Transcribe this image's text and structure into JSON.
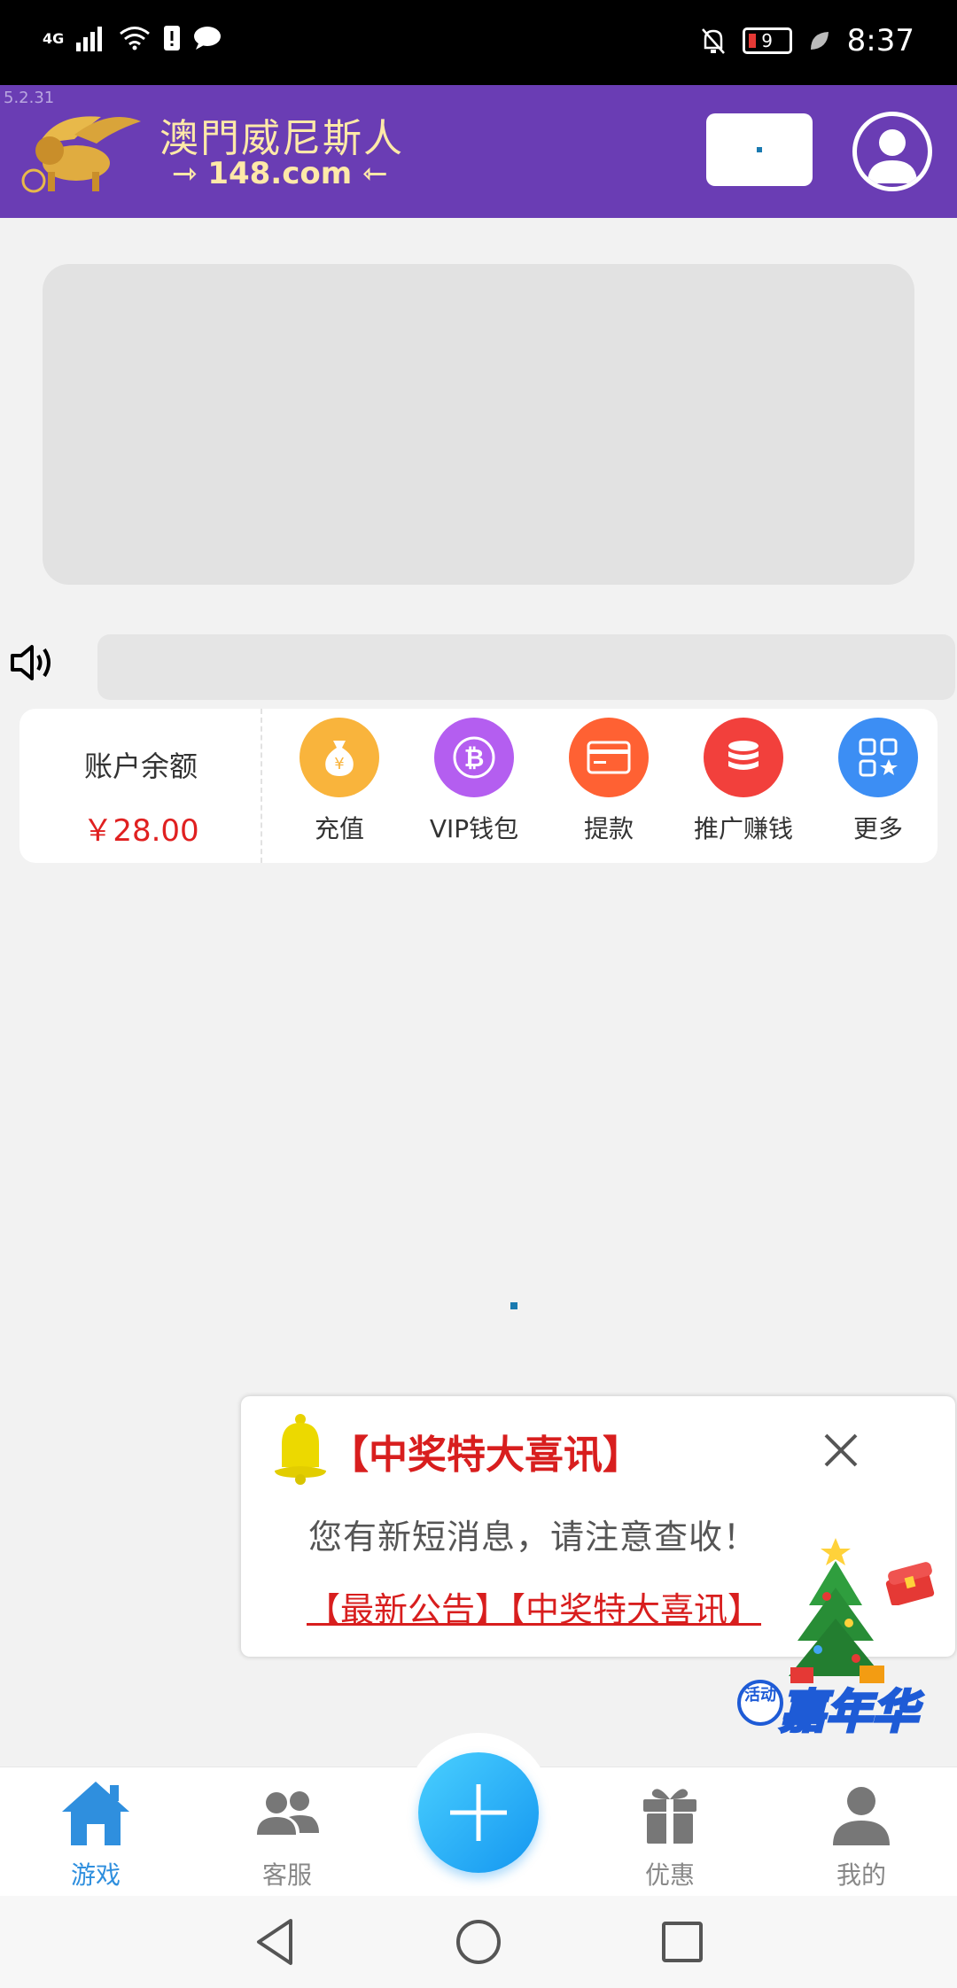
{
  "status_bar": {
    "network": "4G",
    "battery_level": "9",
    "time": "8:37"
  },
  "header": {
    "version": "5.2.31",
    "logo_title": "澳門威尼斯人",
    "logo_domain": "148.com",
    "colors": {
      "header_bg": "#6a3db4",
      "logo_gold": "#ffe9a8"
    }
  },
  "quick_bar": {
    "balance_label": "账户余额",
    "balance_value": "￥28.00",
    "actions": [
      {
        "label": "充值",
        "icon": "money-bag-icon",
        "color": "#f9b43c"
      },
      {
        "label": "VIP钱包",
        "icon": "bitcoin-icon",
        "color": "#b45ef0"
      },
      {
        "label": "提款",
        "icon": "card-icon",
        "color": "#ff6133"
      },
      {
        "label": "推广赚钱",
        "icon": "coins-icon",
        "color": "#f2403c"
      },
      {
        "label": "更多",
        "icon": "grid-icon",
        "color": "#3c8ef4"
      }
    ]
  },
  "popup": {
    "title": "【中奖特大喜讯】",
    "message": "您有新短消息，请注意查收！",
    "links": "【最新公告】【中奖特大喜讯】"
  },
  "carnival": {
    "badge": "活动",
    "text": "嘉年华"
  },
  "tabbar": {
    "tabs": [
      {
        "label": "游戏",
        "icon": "home-icon",
        "active": true
      },
      {
        "label": "客服",
        "icon": "people-icon",
        "active": false
      },
      {
        "label": "优惠",
        "icon": "gift-icon",
        "active": false
      },
      {
        "label": "我的",
        "icon": "user-icon",
        "active": false
      }
    ],
    "active_color": "#2f8fde"
  }
}
